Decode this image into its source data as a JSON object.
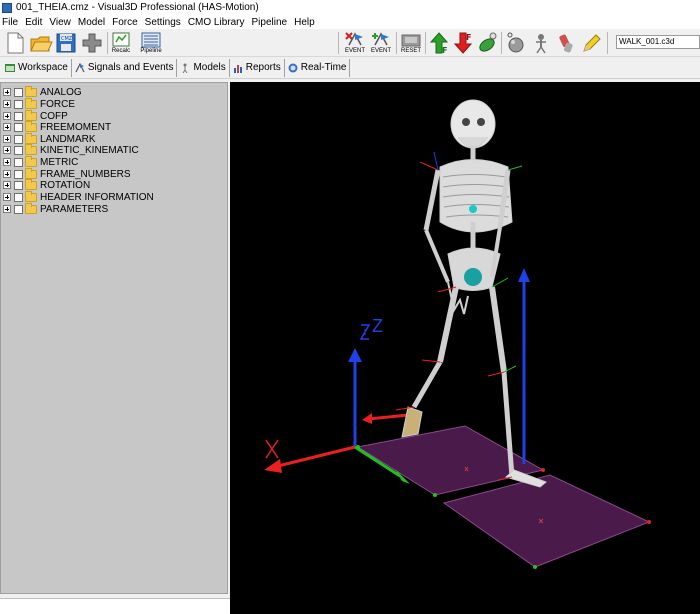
{
  "window": {
    "title": "001_THEIA.cmz - Visual3D Professional (HAS-Motion)"
  },
  "menu": [
    "File",
    "Edit",
    "View",
    "Model",
    "Force",
    "Settings",
    "CMO Library",
    "Pipeline",
    "Help"
  ],
  "toolbar": {
    "recalc_label": "Recalc",
    "pipeline_label": "Pipeline",
    "event_label_1": "EVENT",
    "event_label_2": "EVENT",
    "reset_label": "RESET",
    "force_f": "F",
    "file_field_value": "WALK_001.c3d"
  },
  "tabs": [
    "Workspace",
    "Signals and Events",
    "Models",
    "Reports",
    "Real-Time"
  ],
  "tree": {
    "items": [
      "ANALOG",
      "FORCE",
      "COFP",
      "FREEMOMENT",
      "LANDMARK",
      "KINETIC_KINEMATIC",
      "METRIC",
      "FRAME_NUMBERS",
      "ROTATION",
      "HEADER INFORMATION",
      "PARAMETERS"
    ]
  },
  "viewport": {
    "axis_z_label": "Z",
    "colors": {
      "x_axis": "#e82020",
      "y_axis": "#1ec21e",
      "z_axis": "#2040e8",
      "force_plate": "#4a1a4a",
      "bone": "#e8e8e8"
    }
  }
}
